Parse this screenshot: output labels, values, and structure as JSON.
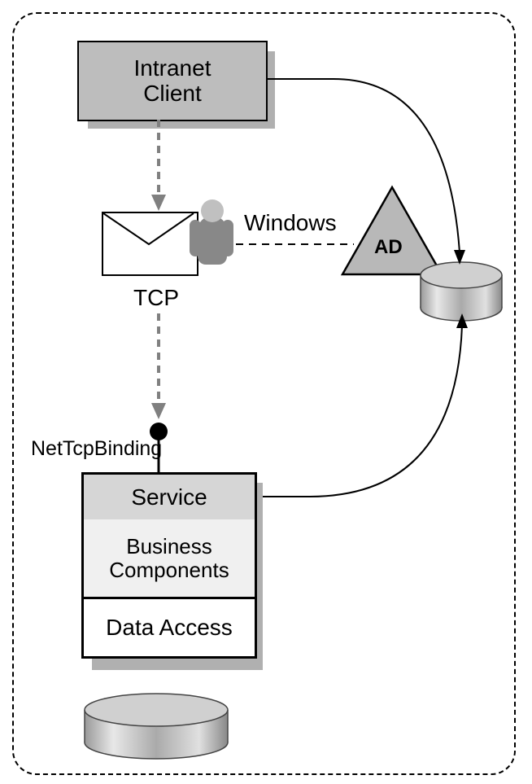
{
  "nodes": {
    "client_label": "Intranet\nClient",
    "tcp_label": "TCP",
    "windows_label": "Windows",
    "ad_label": "AD",
    "nettcp_label": "NetTcpBinding",
    "service_label": "Service",
    "business_label": "Business\nComponents",
    "dataaccess_label": "Data Access"
  },
  "icons": {
    "envelope": "envelope-icon",
    "person": "person-icon",
    "triangle": "ad-triangle",
    "cylinder_bottom": "database-cylinder",
    "cylinder_right": "datastore-cylinder"
  },
  "edges": [
    {
      "from": "client",
      "to": "envelope",
      "style": "dashed-arrow"
    },
    {
      "from": "envelope",
      "to": "service-endpoint",
      "style": "dashed-arrow"
    },
    {
      "from": "person",
      "to": "ad-triangle",
      "style": "dashed-line",
      "label": "Windows"
    },
    {
      "from": "client",
      "to": "right-cylinder",
      "style": "solid-arrow-curved"
    },
    {
      "from": "service",
      "to": "right-cylinder",
      "style": "solid-arrow-curved"
    }
  ]
}
